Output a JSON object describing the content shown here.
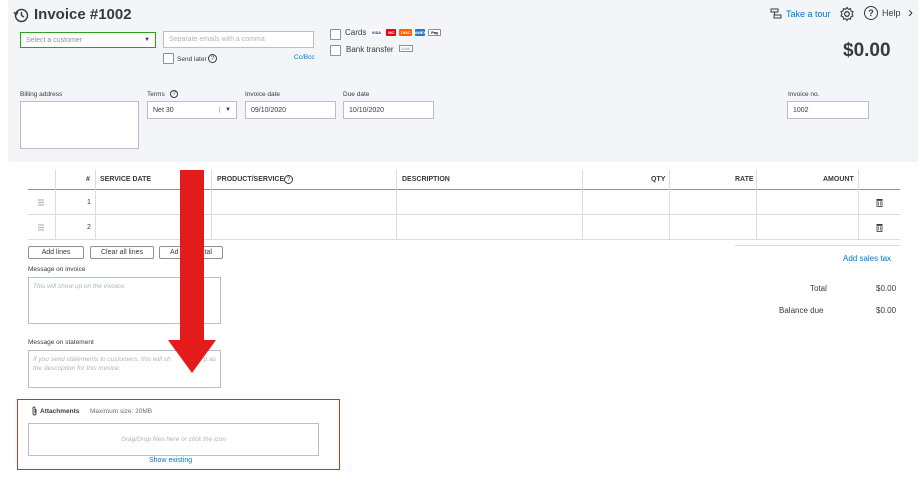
{
  "header": {
    "title": "Invoice #1002",
    "take_tour": "Take a tour",
    "help": "Help"
  },
  "customer": {
    "placeholder": "Select a customer",
    "email_placeholder": "Separate emails with a comma",
    "send_later": "Send later",
    "cc_bcc": "Cc/Bcc"
  },
  "payment": {
    "cards_label": "Cards",
    "card_brands": [
      "VISA",
      "MC",
      "DISC",
      "AMEX",
      "Pay"
    ],
    "bank_transfer": "Bank transfer",
    "bank_badge": "BANK"
  },
  "balance": {
    "amount": "$0.00"
  },
  "fields": {
    "billing_address": "Billing address",
    "terms_label": "Terms",
    "terms_value": "Net 30",
    "invoice_date_label": "Invoice date",
    "invoice_date_value": "09/10/2020",
    "due_date_label": "Due date",
    "due_date_value": "10/10/2020",
    "invoice_no_label": "Invoice no.",
    "invoice_no_value": "1002"
  },
  "table": {
    "columns": {
      "num": "#",
      "service_date": "SERVICE DATE",
      "product_service": "PRODUCT/SERVICE",
      "description": "DESCRIPTION",
      "qty": "QTY",
      "rate": "RATE",
      "amount": "AMOUNT"
    },
    "rows": [
      {
        "num": "1"
      },
      {
        "num": "2"
      }
    ]
  },
  "actions": {
    "add_lines": "Add lines",
    "clear_all_lines": "Clear all lines",
    "add_subtotal_visible": "Ad",
    "add_subtotal_tail": "tal",
    "add_sales_tax": "Add sales tax"
  },
  "messages": {
    "invoice_label": "Message on invoice",
    "invoice_placeholder": "This will show up on the invoice.",
    "statement_label": "Message on statement",
    "statement_placeholder_line1": "If you send statements to customers, this will sh",
    "statement_placeholder_line1_tail": "p as",
    "statement_placeholder_line2": "the description for this invoice."
  },
  "totals": {
    "total_label": "Total",
    "total_value": "$0.00",
    "balance_due_label": "Balance due",
    "balance_due_value": "$0.00"
  },
  "attachments": {
    "label": "Attachments",
    "max_size": "Maximum size: 20MB",
    "dropzone": "Drag/Drop files here or click the icon",
    "show_existing": "Show existing"
  },
  "colors": {
    "annotation_red": "#e31b1b",
    "link_blue": "#0077c5",
    "focus_green": "#2ca01c"
  }
}
